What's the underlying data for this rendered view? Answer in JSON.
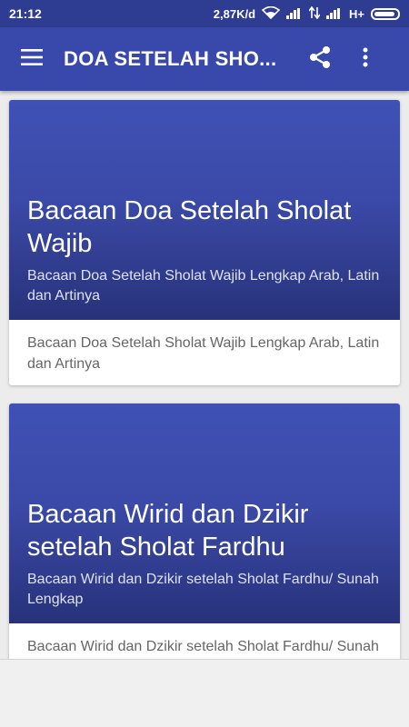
{
  "status_bar": {
    "time": "21:12",
    "speed": "2,87K/d",
    "network": "H+",
    "icons": [
      "wifi-icon",
      "signal-icon",
      "data-arrows-icon",
      "signal-icon",
      "battery-icon"
    ]
  },
  "app_bar": {
    "title": "DOA SETELAH SHO...",
    "icons": [
      "menu-icon",
      "share-icon",
      "more-vert-icon"
    ]
  },
  "cards": [
    {
      "title": "Bacaan Doa Setelah Sholat Wajib",
      "subtitle": "Bacaan Doa Setelah Sholat Wajib Lengkap Arab, Latin dan Artinya",
      "description": "Bacaan Doa Setelah Sholat Wajib Lengkap Arab, Latin dan Artinya"
    },
    {
      "title": "Bacaan Wirid dan Dzikir setelah Sholat Fardhu",
      "subtitle": "Bacaan Wirid dan Dzikir setelah Sholat Fardhu/ Sunah Lengkap",
      "description": "Bacaan Wirid dan Dzikir setelah Sholat Fardhu/ Sunah Lengkap"
    }
  ],
  "colors": {
    "status_bar": "#2e3c91",
    "app_bar": "#3949ab",
    "card_hero": "#3f51b5"
  }
}
